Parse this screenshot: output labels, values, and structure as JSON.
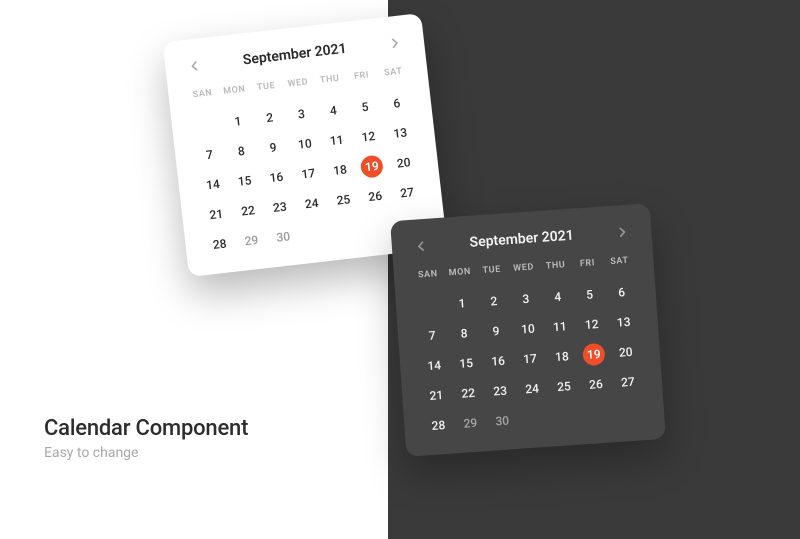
{
  "caption": {
    "title": "Calendar Component",
    "subtitle": "Easy to change"
  },
  "calendar": {
    "month_label": "September 2021",
    "selected_day": 19,
    "inactive_days": [
      29,
      30
    ],
    "day_headers": [
      "SAN",
      "MON",
      "TUE",
      "WED",
      "THU",
      "FRI",
      "SAT"
    ],
    "weeks": [
      [
        null,
        1,
        2,
        3,
        4,
        5,
        6
      ],
      [
        7,
        8,
        9,
        10,
        11,
        12,
        13
      ],
      [
        14,
        15,
        16,
        17,
        18,
        19,
        20
      ],
      [
        21,
        22,
        23,
        24,
        25,
        26,
        27
      ],
      [
        28,
        29,
        30,
        null,
        null,
        null,
        null
      ]
    ]
  },
  "colors": {
    "accent": "#f04e28",
    "dark_bg": "#3a3a3a",
    "card_dark": "#464646"
  }
}
